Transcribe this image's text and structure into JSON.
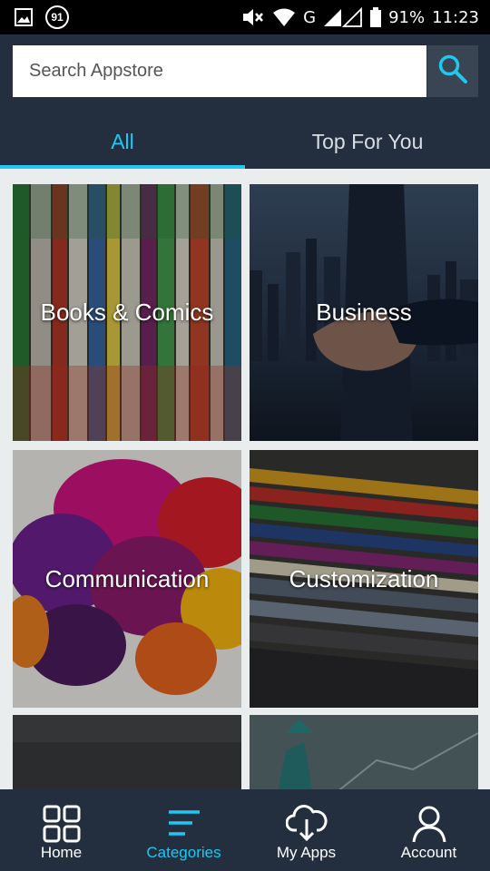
{
  "status_bar": {
    "notification_count": "91",
    "network": "G",
    "battery": "91%",
    "time": "11:23"
  },
  "search": {
    "placeholder": "Search Appstore"
  },
  "tabs": [
    {
      "label": "All",
      "active": true
    },
    {
      "label": "Top For You",
      "active": false
    }
  ],
  "categories": [
    {
      "label": "Books & Comics"
    },
    {
      "label": "Business"
    },
    {
      "label": "Communication"
    },
    {
      "label": "Customization"
    },
    {
      "label": ""
    },
    {
      "label": ""
    }
  ],
  "bottom_nav": [
    {
      "label": "Home",
      "icon": "grid-icon"
    },
    {
      "label": "Categories",
      "icon": "menu-lines-icon",
      "active": true
    },
    {
      "label": "My Apps",
      "icon": "cloud-download-icon"
    },
    {
      "label": "Account",
      "icon": "user-icon"
    }
  ],
  "colors": {
    "header_bg": "#232f3e",
    "accent": "#1ec8f0",
    "page_bg": "#eaeded"
  }
}
